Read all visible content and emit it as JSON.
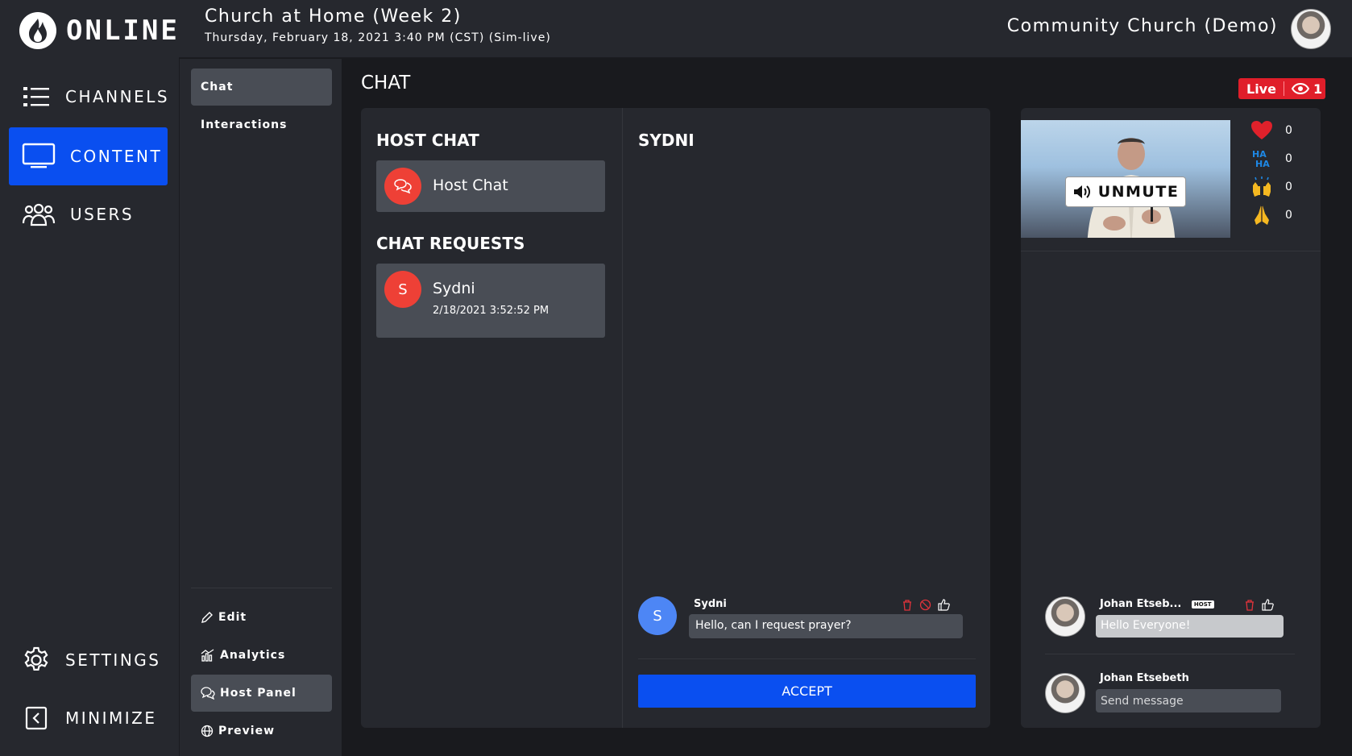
{
  "brand": {
    "logo_text": "ONLINE"
  },
  "nav": {
    "items": [
      {
        "label": "CHANNELS",
        "icon": "list-icon"
      },
      {
        "label": "CONTENT",
        "icon": "monitor-icon",
        "active": true
      },
      {
        "label": "USERS",
        "icon": "users-icon"
      }
    ],
    "bottom": [
      {
        "label": "SETTINGS",
        "icon": "gear-icon"
      },
      {
        "label": "MINIMIZE",
        "icon": "collapse-icon"
      }
    ]
  },
  "header": {
    "title": "Church at Home (Week 2)",
    "subtitle": "Thursday, February 18, 2021 3:40 PM (CST) (Sim-live)",
    "org_name": "Community Church (Demo)"
  },
  "subnav": {
    "items": [
      {
        "label": "Chat",
        "active": true
      },
      {
        "label": "Interactions"
      }
    ],
    "bottom": [
      {
        "label": "Edit",
        "icon": "pencil-icon"
      },
      {
        "label": "Analytics",
        "icon": "analytics-icon"
      },
      {
        "label": "Host Panel",
        "icon": "chat-bubbles-icon",
        "active": true
      },
      {
        "label": "Preview",
        "icon": "globe-icon"
      }
    ]
  },
  "main": {
    "title": "CHAT",
    "live": {
      "label": "Live",
      "viewers": "1"
    },
    "host_chat": {
      "section_title": "HOST CHAT",
      "label": "Host Chat"
    },
    "requests": {
      "section_title": "CHAT REQUESTS",
      "items": [
        {
          "initial": "S",
          "name": "Sydni",
          "time": "2/18/2021 3:52:52 PM"
        }
      ]
    },
    "conversation": {
      "title": "SYDNI",
      "messages": [
        {
          "initial": "S",
          "author": "Sydni",
          "text": "Hello, can I request prayer?"
        }
      ],
      "accept_label": "ACCEPT"
    }
  },
  "right_panel": {
    "unmute_label": "UNMUTE",
    "reactions": [
      {
        "icon": "heart-icon",
        "count": "0"
      },
      {
        "icon": "haha-icon",
        "count": "0",
        "text": "HA HA"
      },
      {
        "icon": "raised-hands-icon",
        "count": "0"
      },
      {
        "icon": "praying-hands-icon",
        "count": "0"
      }
    ],
    "messages": [
      {
        "author": "Johan Etseb...",
        "tag": "HOST",
        "text": "Hello Everyone!"
      }
    ],
    "composer": {
      "author": "Johan Etsebeth",
      "placeholder": "Send message"
    }
  },
  "colors": {
    "accent": "#0a4ff0",
    "live_red": "#e01e2a",
    "avatar_red": "#ee4036",
    "avatar_blue": "#4d86f5"
  }
}
